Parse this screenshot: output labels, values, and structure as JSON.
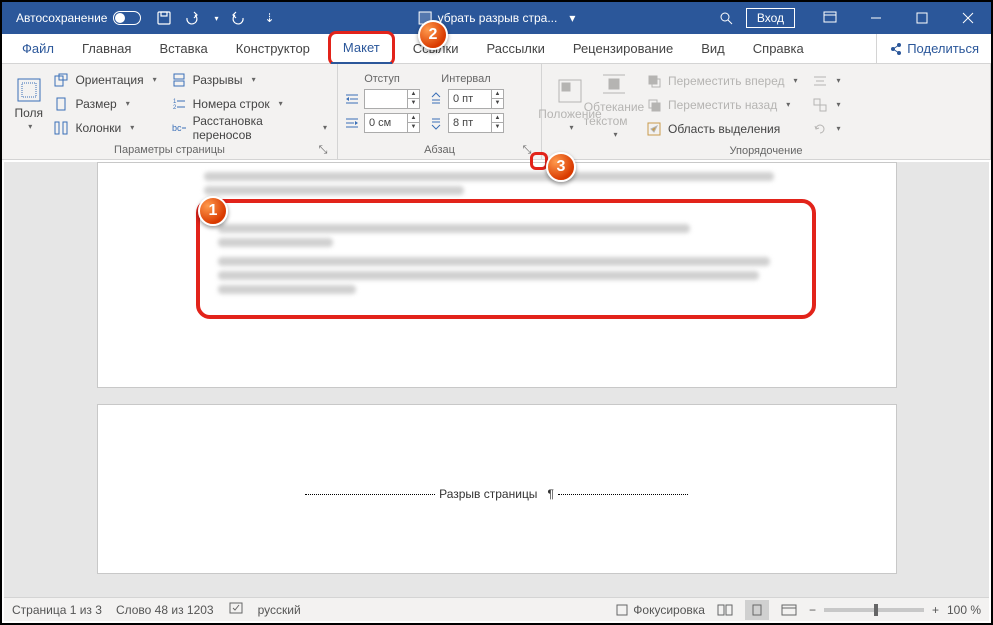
{
  "titlebar": {
    "autosave": "Автосохранение",
    "doc_title": "убрать разрыв стра...",
    "login": "Вход"
  },
  "tabs": {
    "file": "Файл",
    "home": "Главная",
    "insert": "Вставка",
    "design": "Конструктор",
    "layout": "Макет",
    "references": "Ссылки",
    "mailings": "Рассылки",
    "review": "Рецензирование",
    "view": "Вид",
    "help": "Справка",
    "share": "Поделиться"
  },
  "ribbon": {
    "page_setup": {
      "margins": "Поля",
      "orientation": "Ориентация",
      "size": "Размер",
      "columns": "Колонки",
      "breaks": "Разрывы",
      "line_numbers": "Номера строк",
      "hyphenation": "Расстановка переносов",
      "label": "Параметры страницы"
    },
    "paragraph": {
      "indent_label": "Отступ",
      "spacing_label": "Интервал",
      "indent_left": "",
      "indent_right": "0 см",
      "space_before": "0 пт",
      "space_after": "8 пт",
      "label": "Абзац"
    },
    "arrange": {
      "position": "Положение",
      "wrap": "Обтекание текстом",
      "bring_forward": "Переместить вперед",
      "send_backward": "Переместить назад",
      "selection_pane": "Область выделения",
      "label": "Упорядочение"
    }
  },
  "document": {
    "page_break": "Разрыв страницы"
  },
  "statusbar": {
    "page": "Страница 1 из 3",
    "words": "Слово 48 из 1203",
    "lang": "русский",
    "focus": "Фокусировка",
    "zoom": "100 %"
  },
  "callouts": {
    "c1": "1",
    "c2": "2",
    "c3": "3"
  }
}
